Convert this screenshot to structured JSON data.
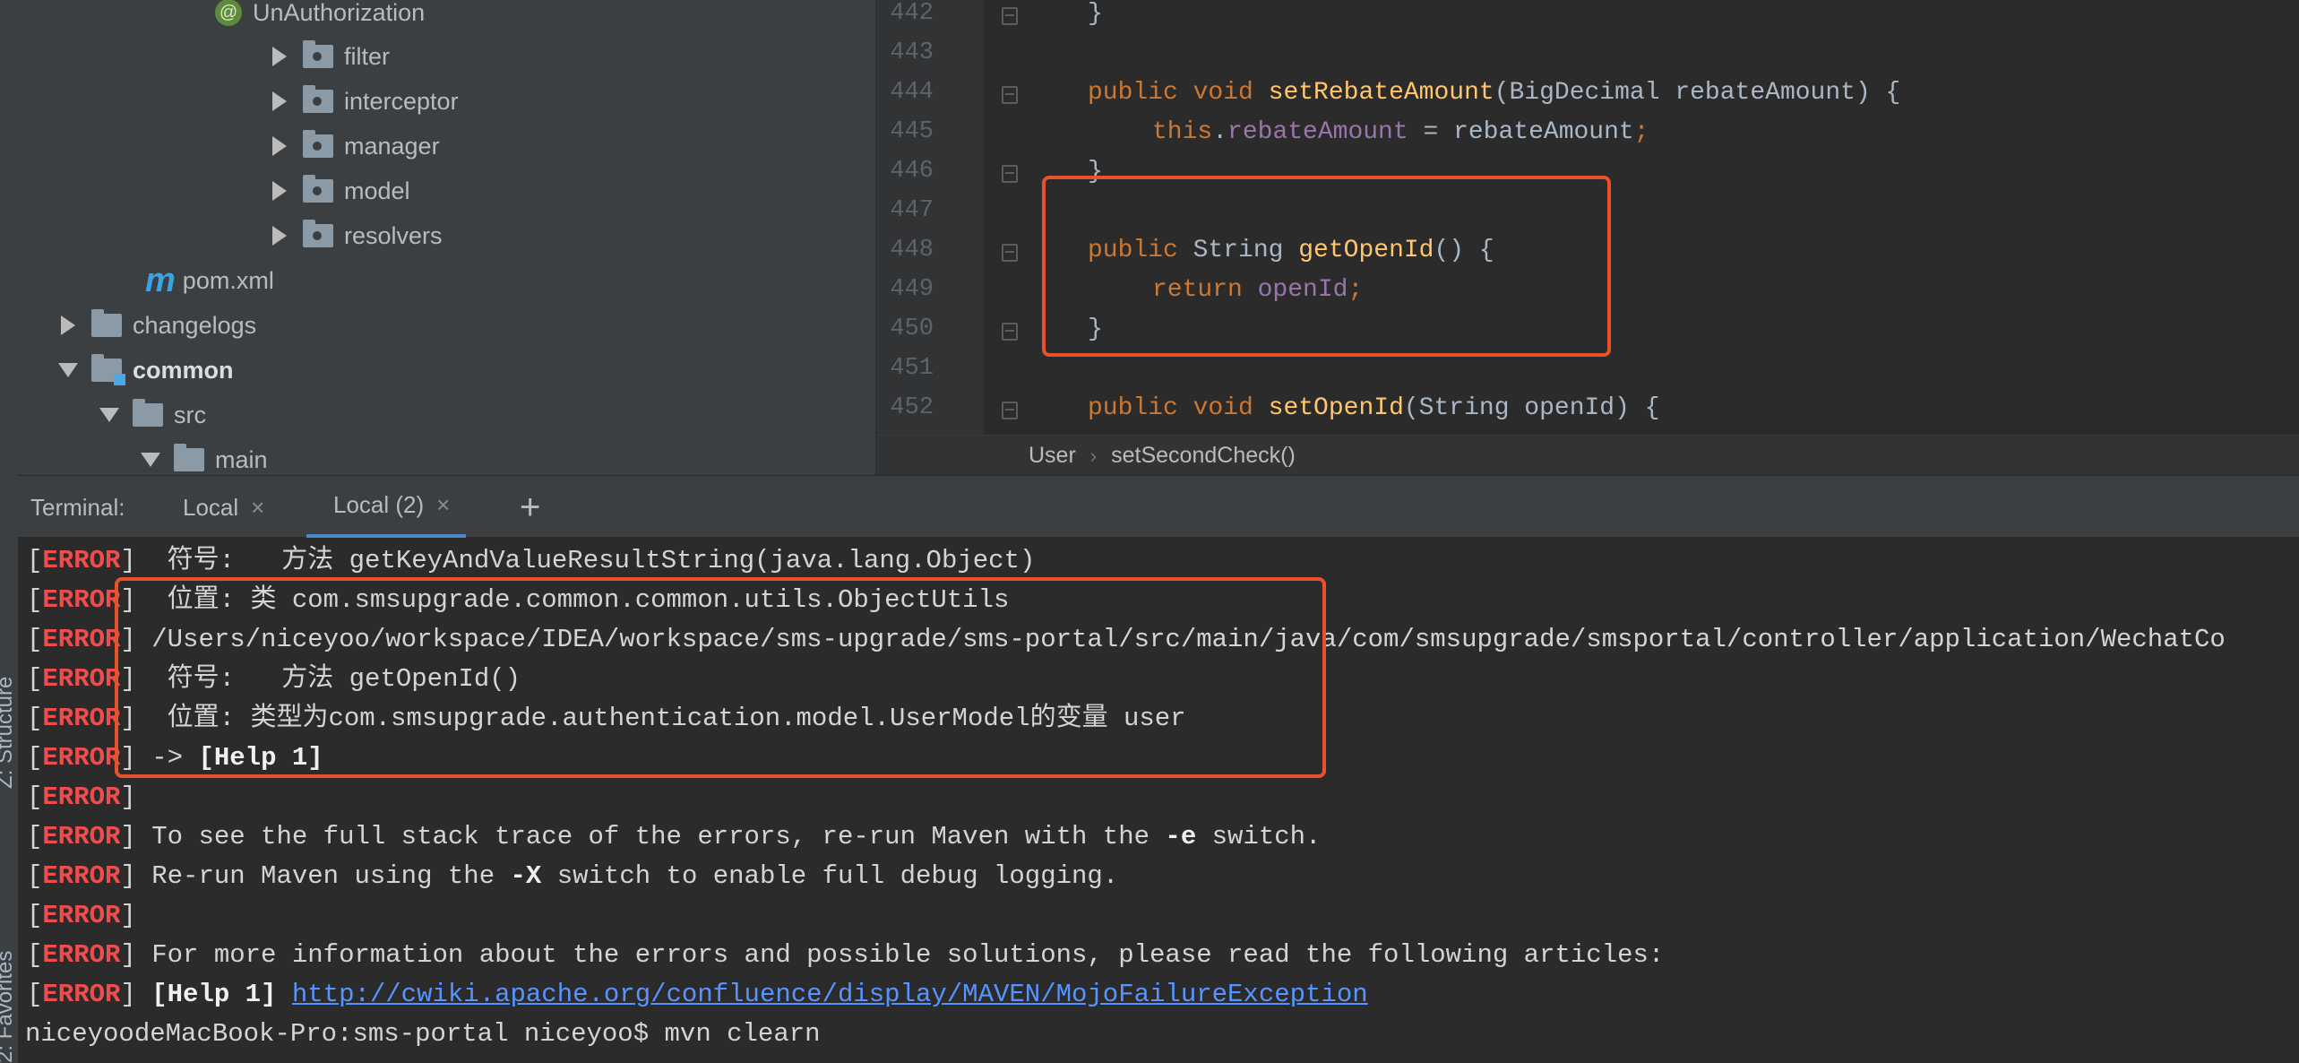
{
  "project_tree": {
    "items": [
      {
        "label": "UnAuthorization",
        "icon": "annotation-icon",
        "arrow": "none"
      },
      {
        "label": "filter",
        "icon": "package-folder-icon",
        "arrow": "collapsed"
      },
      {
        "label": "interceptor",
        "icon": "package-folder-icon",
        "arrow": "collapsed"
      },
      {
        "label": "manager",
        "icon": "package-folder-icon",
        "arrow": "collapsed"
      },
      {
        "label": "model",
        "icon": "package-folder-icon",
        "arrow": "collapsed"
      },
      {
        "label": "resolvers",
        "icon": "package-folder-icon",
        "arrow": "collapsed"
      },
      {
        "label": "pom.xml",
        "icon": "maven-icon",
        "arrow": "none"
      },
      {
        "label": "changelogs",
        "icon": "folder-icon",
        "arrow": "collapsed"
      },
      {
        "label": "common",
        "icon": "module-folder-icon",
        "arrow": "expanded"
      },
      {
        "label": "src",
        "icon": "folder-icon",
        "arrow": "expanded"
      },
      {
        "label": "main",
        "icon": "folder-icon",
        "arrow": "expanded"
      }
    ],
    "annotation_glyph": "@",
    "maven_glyph": "m"
  },
  "side_labels": {
    "structure": "Z: Structure",
    "favorites": "2: Favorites"
  },
  "editor": {
    "line_numbers": [
      "442",
      "443",
      "444",
      "445",
      "446",
      "447",
      "448",
      "449",
      "450",
      "451",
      "452"
    ],
    "code": {
      "l442_brace": "}",
      "l444_kw": "public void ",
      "l444_fn": "setRebateAmount",
      "l444_rest": "(BigDecimal rebateAmount) {",
      "l445_this": "this",
      "l445_dot": ".",
      "l445_field": "rebateAmount",
      "l445_rest": " = rebateAmount",
      "l445_semi": ";",
      "l446_brace": "}",
      "l448_kw": "public ",
      "l448_type": "String ",
      "l448_fn": "getOpenId",
      "l448_rest": "() {",
      "l449_kw": "return ",
      "l449_field": "openId",
      "l449_semi": ";",
      "l450_brace": "}",
      "l452_kw": "public void ",
      "l452_fn": "setOpenId",
      "l452_rest": "(String openId) {"
    }
  },
  "breadcrumb": {
    "class_name": "User",
    "separator": "›",
    "method": "setSecondCheck()"
  },
  "terminal": {
    "title": "Terminal:",
    "tabs": [
      {
        "label": "Local",
        "active": false
      },
      {
        "label": "Local (2)",
        "active": true
      }
    ],
    "close_glyph": "×",
    "add_glyph": "+",
    "error_tag": "ERROR",
    "lines": [
      {
        "text": "  符号:   方法 getKeyAndValueResultString(java.lang.Object)"
      },
      {
        "text": "  位置: 类 com.smsupgrade.common.common.utils.ObjectUtils"
      },
      {
        "text": " /Users/niceyoo/workspace/IDEA/workspace/sms-upgrade/sms-portal/src/main/java/com/smsupgrade/smsportal/controller/application/WechatCo"
      },
      {
        "text": "  符号:   方法 getOpenId()"
      },
      {
        "text": "  位置: 类型为com.smsupgrade.authentication.model.UserModel的变量 user"
      },
      {
        "text_pre": " -> ",
        "text_bold": "[Help 1]"
      },
      {
        "text": ""
      },
      {
        "text_pre": " To see the full stack trace of the errors, re-run Maven with the ",
        "text_bold": "-e",
        "text_post": " switch."
      },
      {
        "text_pre": " Re-run Maven using the ",
        "text_bold": "-X",
        "text_post": " switch to enable full debug logging."
      },
      {
        "text": ""
      },
      {
        "text": " For more information about the errors and possible solutions, please read the following articles:"
      },
      {
        "text_bold": " [Help 1] ",
        "link": "http://cwiki.apache.org/confluence/display/MAVEN/MojoFailureException"
      }
    ],
    "prompt_line": "niceyoodeMacBook-Pro:sms-portal niceyoo$ mvn clearn"
  },
  "colors": {
    "highlight_box": "#e8522a",
    "error": "#ef4d4d",
    "keyword": "#cc7832",
    "function": "#ffc66d",
    "field": "#9876aa",
    "link": "#5794ff"
  }
}
